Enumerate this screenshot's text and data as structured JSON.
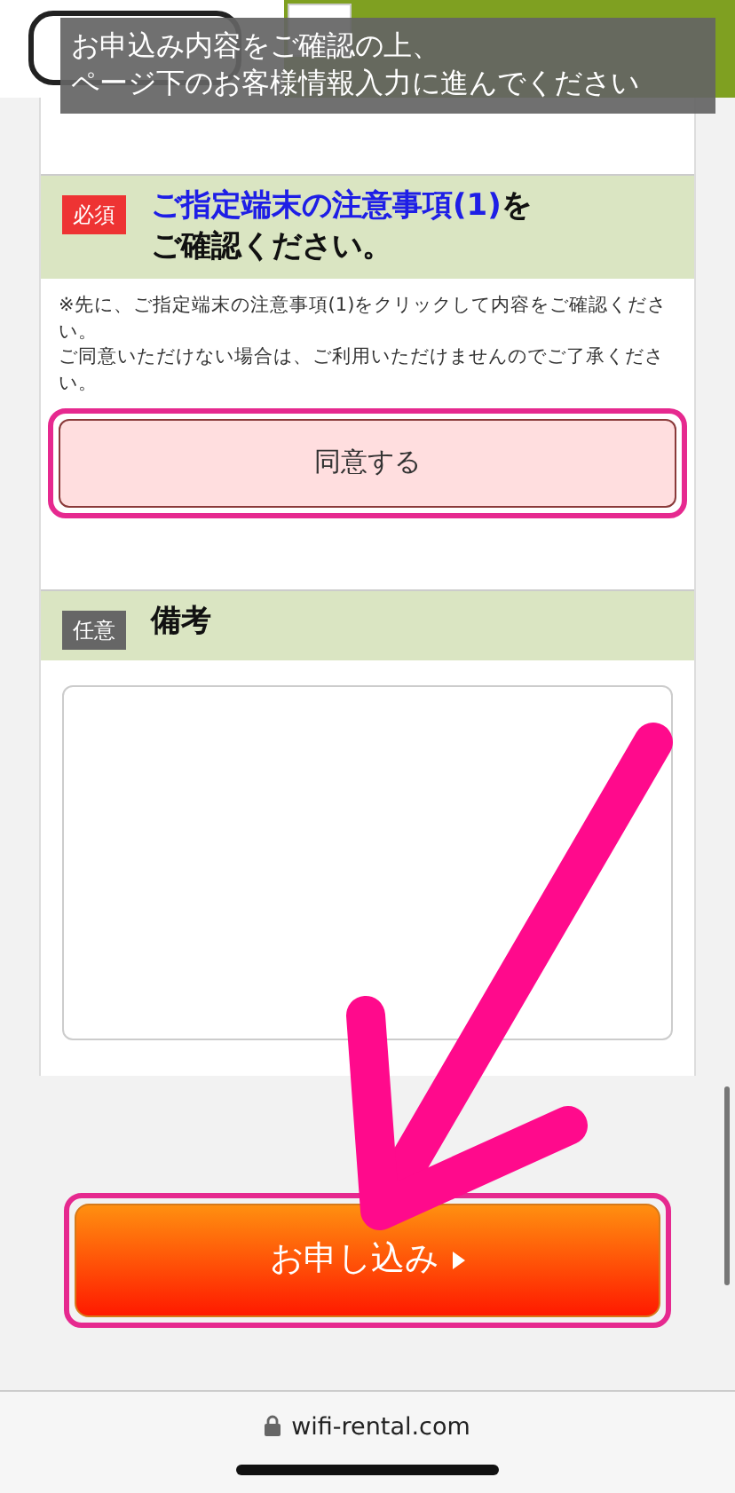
{
  "overlay_caption": [
    "お申込み内容をご確認の上、",
    "ページ下のお客様情報入力に進んでください"
  ],
  "sections": [
    {
      "kind": "required",
      "badge": "必須",
      "title_link": "ご指定端末の注意事項(1)",
      "title_rest": "を",
      "title_line2": "ご確認ください。",
      "notes": [
        "※先に、ご指定端末の注意事項(1)をクリックして内容をご確認ください。",
        "ご同意いただけない場合は、ご利用いただけませんのでご了承ください。"
      ],
      "button": "同意する",
      "highlighted": true
    },
    {
      "kind": "optional",
      "badge": "任意",
      "title_rest": "備考"
    }
  ],
  "submit": {
    "label": "お申し込み",
    "highlighted": true
  },
  "address_bar": {
    "url": "wifi-rental.com"
  }
}
